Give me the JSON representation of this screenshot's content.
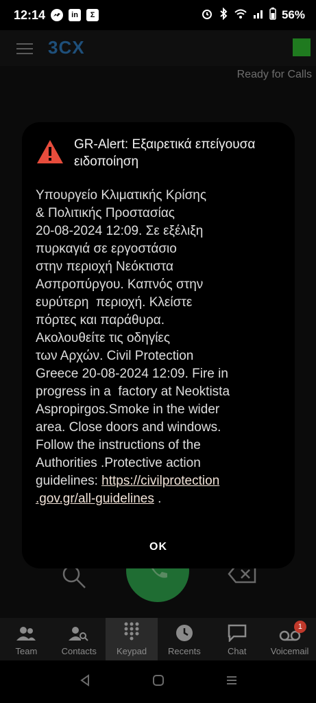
{
  "status_bar": {
    "time": "12:14",
    "battery_percent": "56%",
    "app_icons": [
      "messenger-icon",
      "linkedin-icon",
      "sigma-icon"
    ]
  },
  "header": {
    "logo": "3CX",
    "status_color": "#1f7a1f",
    "ready_text": "Ready for Calls"
  },
  "alert": {
    "title": "GR-Alert: Εξαιρετικά επείγουσα ειδοποίηση",
    "body_text": "Υπουργείο Κλιματικής Κρίσης\n& Πολιτικής Προστασίας\n20-08-2024 12:09. Σε εξέλιξη\nπυρκαγιά σε εργοστάσιο\nστην περιοχή Νεόκτιστα\nΑσπροπύργου. Καπνός στην\nευρύτερη  περιοχή. Κλείστε\nπόρτες και παράθυρα.\nΑκολουθείτε τις οδηγίες\nτων Αρχών. Civil Protection\nGreece 20-08-2024 12:09. Fire in\nprogress in a  factory at Neoktista\nAspropirgos.Smoke in the wider\narea. Close doors and windows.\nFollow the instructions of the\nAuthorities .Protective action\nguidelines: ",
    "link_text": "https://civilprotection\n.gov.gr/all-guidelines",
    "after_link": " .",
    "ok_label": "OK",
    "icon_color": "#e74c3c"
  },
  "bottom_nav": {
    "items": [
      {
        "label": "Team",
        "icon": "team-icon",
        "active": false
      },
      {
        "label": "Contacts",
        "icon": "contacts-search-icon",
        "active": false
      },
      {
        "label": "Keypad",
        "icon": "keypad-icon",
        "active": true
      },
      {
        "label": "Recents",
        "icon": "clock-icon",
        "active": false
      },
      {
        "label": "Chat",
        "icon": "chat-icon",
        "active": false
      },
      {
        "label": "Voicemail",
        "icon": "voicemail-icon",
        "active": false,
        "badge": "1"
      }
    ]
  }
}
